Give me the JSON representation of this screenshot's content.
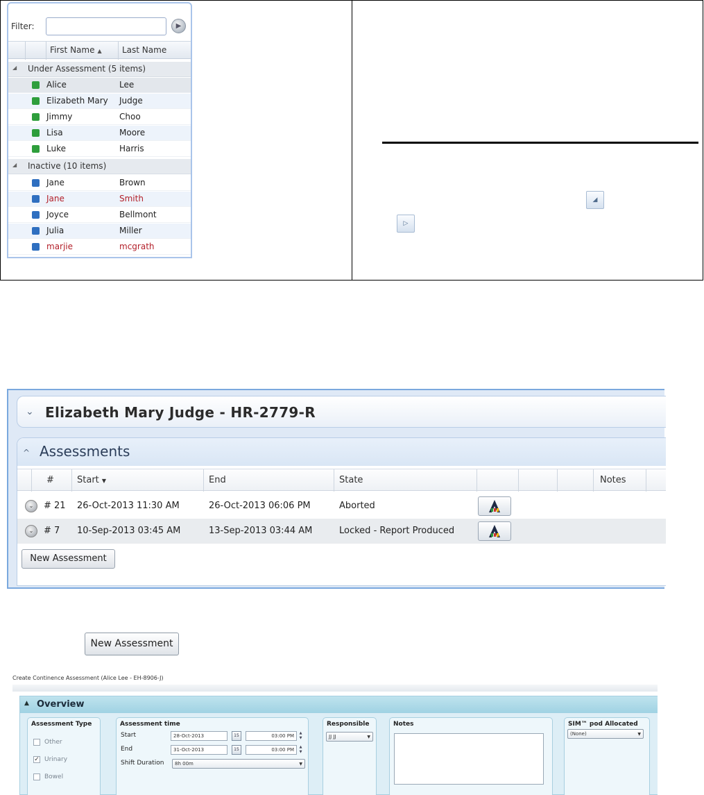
{
  "people_list": {
    "filter_label": "Filter:",
    "filter_value": "",
    "columns": {
      "first_name": "First Name",
      "last_name": "Last Name"
    },
    "groups": [
      {
        "label": "Under Assessment (5 items)",
        "people": [
          {
            "first": "Alice",
            "last": "Lee",
            "status_color": "#2e9e3c",
            "color": "normal"
          },
          {
            "first": "Elizabeth Mary",
            "last": "Judge",
            "status_color": "#2e9e3c",
            "color": "normal"
          },
          {
            "first": "Jimmy",
            "last": "Choo",
            "status_color": "#2e9e3c",
            "color": "normal"
          },
          {
            "first": "Lisa",
            "last": "Moore",
            "status_color": "#2e9e3c",
            "color": "normal"
          },
          {
            "first": "Luke",
            "last": "Harris",
            "status_color": "#2e9e3c",
            "color": "normal"
          }
        ]
      },
      {
        "label": "Inactive (10 items)",
        "people": [
          {
            "first": "Jane",
            "last": "Brown",
            "status_color": "#2f6fc0",
            "color": "normal"
          },
          {
            "first": "Jane",
            "last": "Smith",
            "status_color": "#2f6fc0",
            "color": "#b3202a"
          },
          {
            "first": "Joyce",
            "last": "Bellmont",
            "status_color": "#2f6fc0",
            "color": "normal"
          },
          {
            "first": "Julia",
            "last": "Miller",
            "status_color": "#2f6fc0",
            "color": "normal"
          },
          {
            "first": "marjie",
            "last": "mcgrath",
            "status_color": "#2f6fc0",
            "color": "#b3202a"
          }
        ]
      }
    ]
  },
  "person_header": {
    "title": "Elizabeth Mary Judge - HR-2779-R"
  },
  "assessments": {
    "title": "Assessments",
    "columns": {
      "num": "#",
      "start": "Start",
      "end": "End",
      "state": "State",
      "notes": "Notes"
    },
    "rows": [
      {
        "num": "# 21",
        "start": "26-Oct-2013 11:30 AM",
        "end": "26-Oct-2013 06:06 PM",
        "state": "Aborted",
        "report_icon": "report-a-icon"
      },
      {
        "num": "# 7",
        "start": "10-Sep-2013 03:45 AM",
        "end": "13-Sep-2013 03:44 AM",
        "state": "Locked - Report Produced",
        "report_icon": "report-a-icon"
      }
    ],
    "new_button": "New Assessment"
  },
  "standalone_button": {
    "label": "New Assessment"
  },
  "create_form": {
    "window_title": "Create Continence Assessment (Alice Lee - EH-8906-J)",
    "overview_title": "Overview",
    "assessment_type": {
      "heading": "Assessment Type",
      "options": [
        {
          "label": "Other",
          "checked": false
        },
        {
          "label": "Urinary",
          "checked": true
        },
        {
          "label": "Bowel",
          "checked": false
        }
      ]
    },
    "assessment_time": {
      "heading": "Assessment time",
      "start_label": "Start",
      "start_date": "28-Oct-2013",
      "start_time": "03:00 PM",
      "end_label": "End",
      "end_date": "31-Oct-2013",
      "end_time": "03:00 PM",
      "calendar_day": "15",
      "duration_label": "Shift Duration",
      "duration_value": "8h 00m"
    },
    "responsible": {
      "heading": "Responsible",
      "value": "JJ JJ"
    },
    "notes": {
      "heading": "Notes",
      "value": ""
    },
    "pod": {
      "heading": "SIM™ pod Allocated",
      "value": "(None)"
    }
  }
}
